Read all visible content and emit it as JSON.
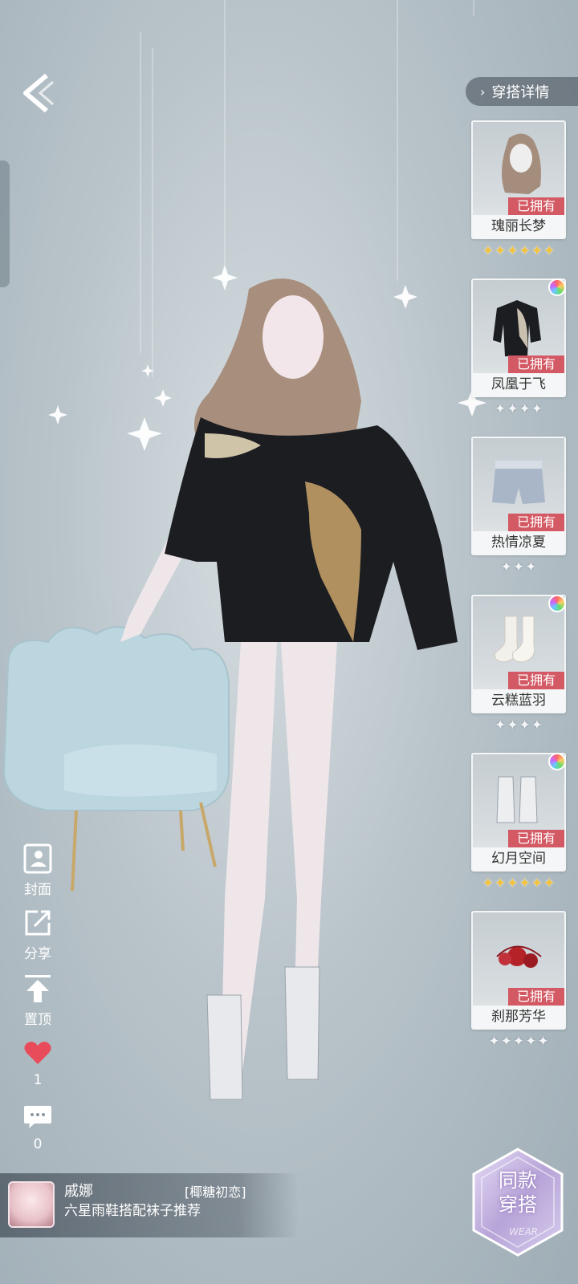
{
  "header": {
    "back_icon": "back-arrow-icon",
    "detail_label": "穿搭详情"
  },
  "items": [
    {
      "name": "瑰丽长梦",
      "owned": "已拥有",
      "stars": 6,
      "star_color": "gold",
      "palette": false,
      "icon": "hair-icon"
    },
    {
      "name": "凤凰于飞",
      "owned": "已拥有",
      "stars": 4,
      "star_color": "silver",
      "palette": true,
      "icon": "sweater-icon"
    },
    {
      "name": "热情凉夏",
      "owned": "已拥有",
      "stars": 3,
      "star_color": "silver",
      "palette": false,
      "icon": "shorts-icon"
    },
    {
      "name": "云糕蓝羽",
      "owned": "已拥有",
      "stars": 4,
      "star_color": "silver",
      "palette": true,
      "icon": "socks-icon"
    },
    {
      "name": "幻月空间",
      "owned": "已拥有",
      "stars": 6,
      "star_color": "gold",
      "palette": true,
      "icon": "boots-icon"
    },
    {
      "name": "刹那芳华",
      "owned": "已拥有",
      "stars": 5,
      "star_color": "silver",
      "palette": false,
      "icon": "flower-ornament-icon"
    }
  ],
  "menu": {
    "cover_label": "封面",
    "share_label": "分享",
    "pin_label": "置顶",
    "like_count": "1",
    "comment_count": "0"
  },
  "user": {
    "name": "戚娜",
    "tag": "[椰糖初恋]",
    "desc": "六星雨鞋搭配袜子推荐"
  },
  "same_outfit": {
    "line1": "同款",
    "line2": "穿搭",
    "watermark": "WEAR"
  },
  "colors": {
    "owned_badge": "#d35a64",
    "gold_star": "#f2c23d",
    "like_heart": "#e84b5a"
  }
}
